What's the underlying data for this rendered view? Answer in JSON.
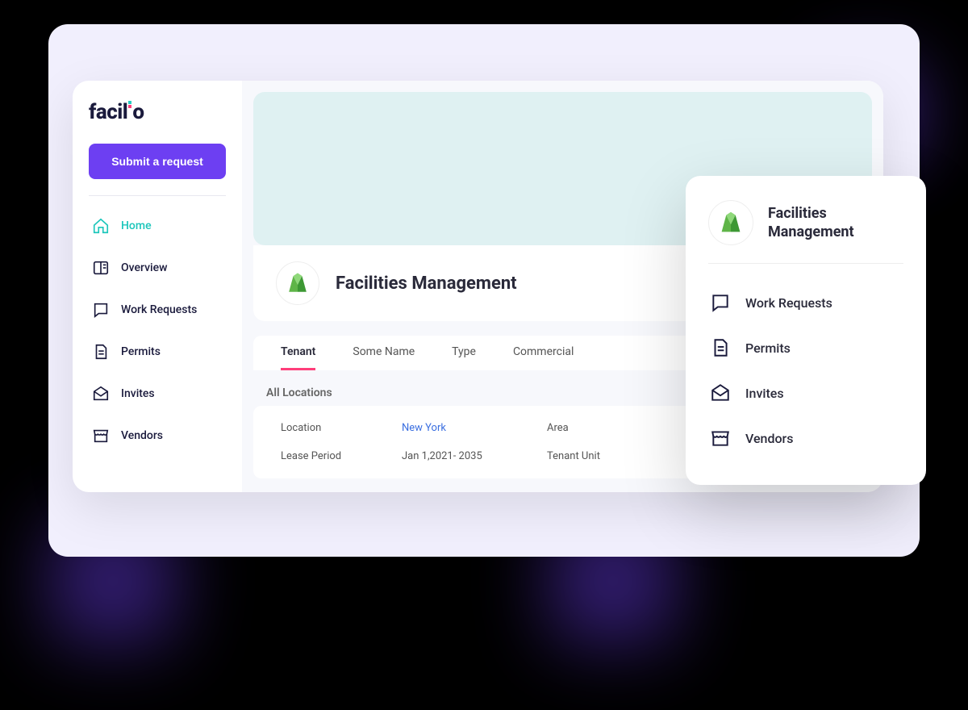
{
  "brand": "facilio",
  "sidebar": {
    "cta": "Submit a request",
    "items": [
      {
        "label": "Home"
      },
      {
        "label": "Overview"
      },
      {
        "label": "Work Requests"
      },
      {
        "label": "Permits"
      },
      {
        "label": "Invites"
      },
      {
        "label": "Vendors"
      }
    ]
  },
  "main": {
    "title": "Facilities Management",
    "tabs": [
      {
        "label": "Tenant"
      },
      {
        "label": "Some Name"
      },
      {
        "label": "Type"
      },
      {
        "label": "Commercial"
      }
    ],
    "section_label": "All Locations",
    "rows": [
      {
        "label": "Location",
        "value": "New York",
        "extra": "Area"
      },
      {
        "label": "Lease Period",
        "value": "Jan 1,2021- 2035",
        "extra": "Tenant Unit"
      }
    ]
  },
  "float": {
    "title": "Facilities Management",
    "items": [
      {
        "label": "Work Requests"
      },
      {
        "label": "Permits"
      },
      {
        "label": "Invites"
      },
      {
        "label": "Vendors"
      }
    ]
  }
}
